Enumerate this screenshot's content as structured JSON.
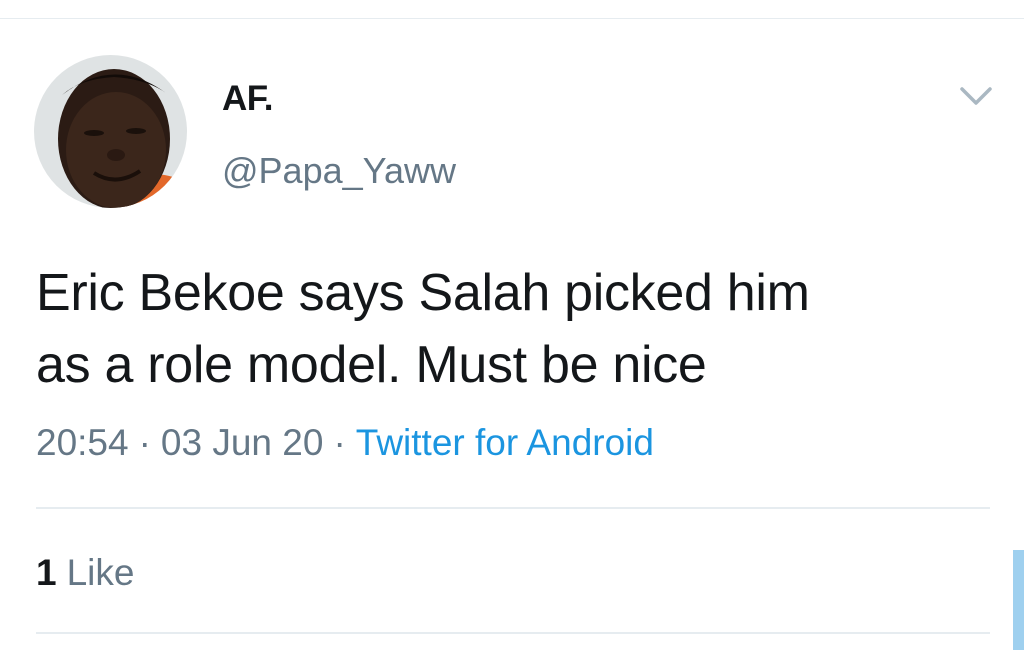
{
  "tweet": {
    "display_name": "AF.",
    "handle": "@Papa_Yaww",
    "text_line1": "Eric Bekoe says Salah picked him",
    "text_line2": "as a role model. Must be nice",
    "time": "20:54",
    "date": "03 Jun 20",
    "separator": "·",
    "source": "Twitter for Android",
    "like_count": "1",
    "like_label": "Like"
  },
  "colors": {
    "text": "#14171a",
    "secondary": "#657786",
    "link": "#1b95e0",
    "divider": "#e6ecf0"
  },
  "icons": {
    "caret": "chevron-down-icon",
    "avatar": "avatar"
  }
}
